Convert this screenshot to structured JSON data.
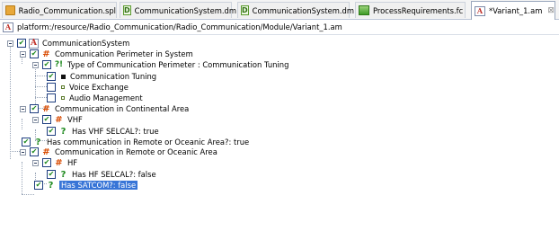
{
  "tabs": [
    {
      "label": "Radio_Communication.spl",
      "icon": "folder-icon",
      "active": false
    },
    {
      "label": "CommunicationSystem.dm",
      "icon": "d-model-icon",
      "active": false
    },
    {
      "label": "CommunicationSystem.dm",
      "icon": "d-model-icon",
      "active": false
    },
    {
      "label": "ProcessRequirements.fc",
      "icon": "feature-chart-icon",
      "active": false
    },
    {
      "label": "*Variant_1.am",
      "icon": "a-model-icon",
      "active": true,
      "close_icon": "close-icon"
    }
  ],
  "path": "platform:/resource/Radio_Communication/Radio_Communication/Module/Variant_1.am",
  "tree": [
    {
      "label": "CommunicationSystem",
      "icon": "a-model-icon",
      "checked": true
    },
    {
      "label": "Communication Perimeter in System",
      "icon": "grid-icon",
      "checked": true
    },
    {
      "label": "Type of Communication Perimeter : Communication Tuning",
      "icon": "question-choice-icon",
      "checked": true
    },
    {
      "label": "Communication Tuning",
      "icon": "filled-dot-icon",
      "checked": true
    },
    {
      "label": "Voice Exchange",
      "icon": "hollow-dot-icon",
      "checked": false
    },
    {
      "label": "Audio Management",
      "icon": "hollow-dot-icon",
      "checked": false
    },
    {
      "label": "Communication in Continental Area",
      "icon": "grid-icon",
      "checked": true
    },
    {
      "label": "VHF",
      "icon": "grid-icon",
      "checked": true
    },
    {
      "label": "Has VHF SELCAL?: true",
      "icon": "question-icon",
      "checked": true
    },
    {
      "label": "Has communication in Remote or Oceanic Area?: true",
      "icon": "question-icon",
      "checked": true
    },
    {
      "label": "Communication in Remote or Oceanic Area",
      "icon": "grid-icon",
      "checked": true
    },
    {
      "label": "HF",
      "icon": "grid-icon",
      "checked": true
    },
    {
      "label": "Has HF SELCAL?: false",
      "icon": "question-icon",
      "checked": true
    },
    {
      "label": "Has SATCOM?: false",
      "icon": "question-icon",
      "checked": true,
      "selected": true
    }
  ]
}
